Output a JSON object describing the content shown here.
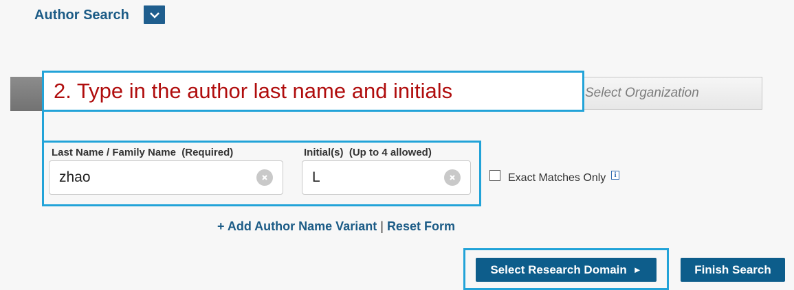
{
  "header": {
    "title": "Author Search",
    "dropdown_icon": "chevron-down-icon"
  },
  "steps": {
    "select_organization": "Select Organization"
  },
  "annotation": {
    "callout_text": "2. Type in the author last name and initials",
    "text_color": "#b00d0d",
    "border_color": "#22a3d8"
  },
  "form": {
    "last_name": {
      "label": "Last Name / Family Name  (Required)",
      "value": "zhao"
    },
    "initials": {
      "label": "Initial(s)  (Up to 4 allowed)",
      "value": "L"
    },
    "exact_matches": {
      "label": "Exact Matches Only",
      "checked": false,
      "info_icon": "i"
    }
  },
  "links": {
    "add_variant": "+ Add Author Name Variant",
    "separator": "|",
    "reset": "Reset Form"
  },
  "buttons": {
    "select_domain": "Select Research Domain",
    "select_domain_arrow": "►",
    "finish": "Finish Search"
  },
  "colors": {
    "brand_blue": "#1b5b86",
    "button_blue": "#0d5d8b"
  }
}
